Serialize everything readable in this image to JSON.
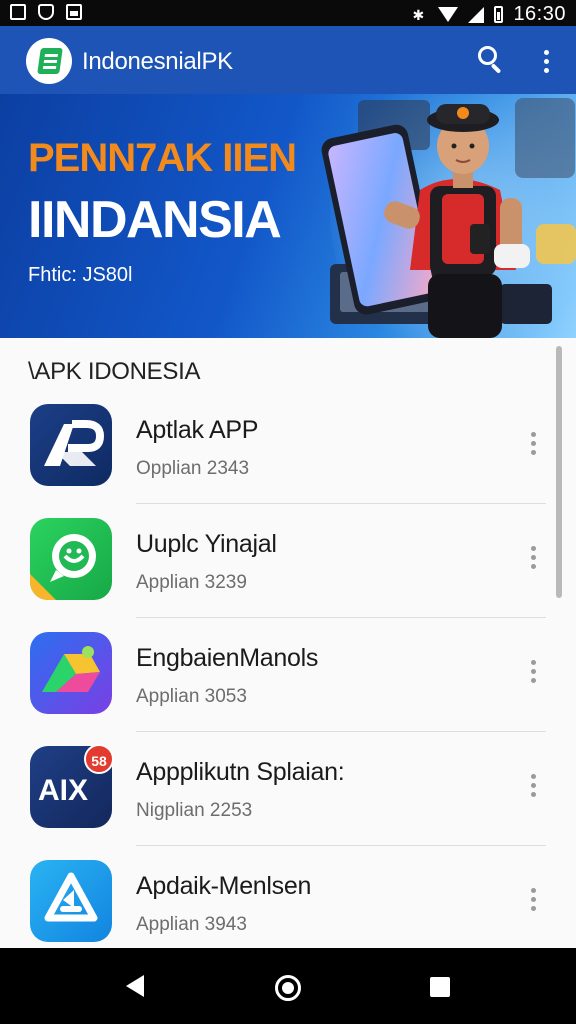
{
  "status_bar": {
    "time": "16:30"
  },
  "app_bar": {
    "title": "IndonesnialPK"
  },
  "banner": {
    "title": "PENN7AK IIEN",
    "subtitle": "IINDANSIA",
    "caption": "Fhtic: JS80l"
  },
  "section": {
    "title": "\\APK IDONESIA"
  },
  "apps": [
    {
      "name": "Aptlak APP",
      "meta": "Opplian 2343",
      "icon": "ap-logo-icon"
    },
    {
      "name": "Uuplc Yinajal",
      "meta": "Applian 3239",
      "icon": "chat-bubble-icon"
    },
    {
      "name": "EngbaienManols",
      "meta": "Applian 3053",
      "icon": "triangle-drive-icon"
    },
    {
      "name": "Appplikutn Splaian:",
      "meta": "Nigplian 2253",
      "icon": "alx-logo-icon",
      "badge": "58"
    },
    {
      "name": "Apdaik-Menlsen",
      "meta": "Applian 3943",
      "icon": "recycle-triangle-icon"
    }
  ],
  "colors": {
    "app_bar": "#1d54b6",
    "banner_title": "#f28a1c",
    "badge": "#e23b2f"
  }
}
